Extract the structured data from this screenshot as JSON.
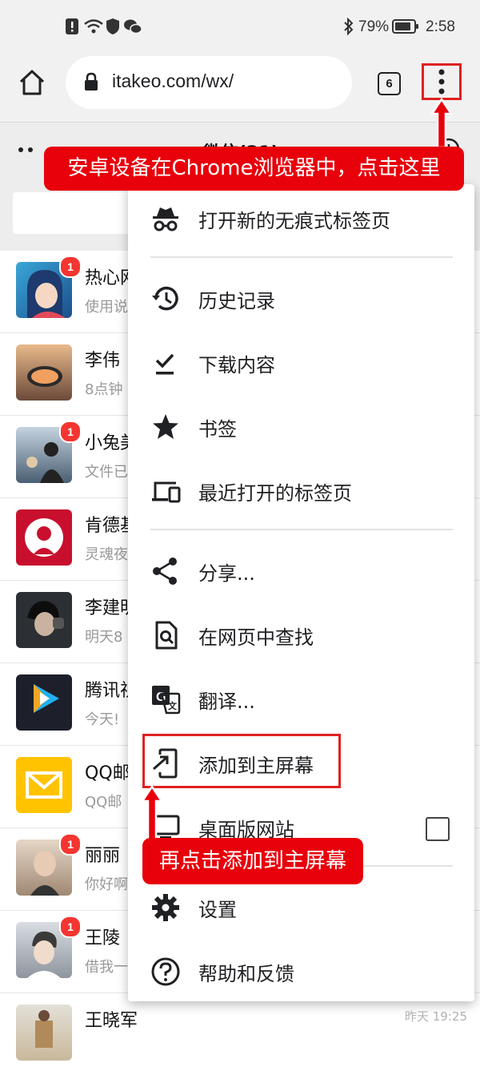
{
  "status_bar": {
    "battery": "79%",
    "time": "2:58"
  },
  "browser": {
    "url": "itakeo.com/wx/",
    "tab_count": "6"
  },
  "page": {
    "title": "微信(21)"
  },
  "chats": [
    {
      "name": "热心网",
      "preview": "使用说",
      "badge": "1",
      "time": ""
    },
    {
      "name": "李伟",
      "preview": "8点钟",
      "badge": "",
      "time": ""
    },
    {
      "name": "小兔美",
      "preview": "文件已",
      "badge": "1",
      "time": ""
    },
    {
      "name": "肯德基",
      "preview": "灵魂夜",
      "badge": "",
      "time": ""
    },
    {
      "name": "李建明",
      "preview": "明天8",
      "badge": "",
      "time": ""
    },
    {
      "name": "腾讯视",
      "preview": "今天!",
      "badge": "",
      "time": ""
    },
    {
      "name": "QQ邮",
      "preview": "QQ邮",
      "badge": "",
      "time": ""
    },
    {
      "name": "丽丽",
      "preview": "你好啊",
      "badge": "1",
      "time": ""
    },
    {
      "name": "王陵",
      "preview": "借我一",
      "badge": "1",
      "time": ""
    },
    {
      "name": "王晓军",
      "preview": "",
      "badge": "",
      "time": "昨天 19:25"
    }
  ],
  "menu": {
    "incognito": "打开新的无痕式标签页",
    "history": "历史记录",
    "downloads": "下载内容",
    "bookmarks": "书签",
    "recent_tabs": "最近打开的标签页",
    "share": "分享...",
    "find": "在网页中查找",
    "translate": "翻译...",
    "add_to_home": "添加到主屏幕",
    "desktop_site": "桌面版网站",
    "settings": "设置",
    "help": "帮助和反馈"
  },
  "annotations": {
    "top": "安卓设备在Chrome浏览器中，点击这里",
    "bottom": "再点击添加到主屏幕"
  },
  "colors": {
    "annotation_red": "#e8000b",
    "badge_red": "#f43530"
  }
}
